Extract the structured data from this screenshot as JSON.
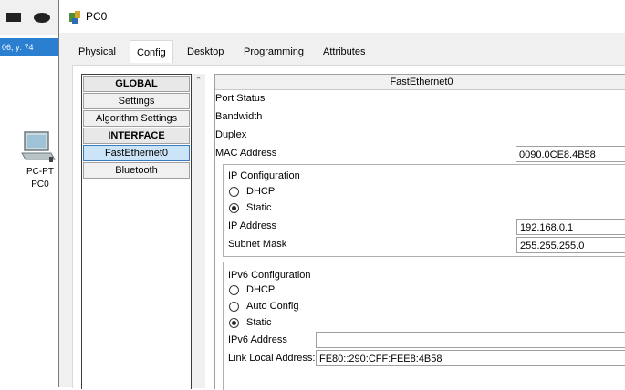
{
  "canvas": {
    "coords_label": "06, y: 74",
    "device_type": "PC-PT",
    "device_name": "PC0"
  },
  "window": {
    "title": "PC0",
    "tabs": [
      {
        "label": "Physical",
        "active": false
      },
      {
        "label": "Config",
        "active": true
      },
      {
        "label": "Desktop",
        "active": false
      },
      {
        "label": "Programming",
        "active": false
      },
      {
        "label": "Attributes",
        "active": false
      }
    ]
  },
  "sidebar": {
    "items": [
      {
        "label": "GLOBAL",
        "kind": "header"
      },
      {
        "label": "Settings",
        "kind": "item"
      },
      {
        "label": "Algorithm Settings",
        "kind": "item"
      },
      {
        "label": "INTERFACE",
        "kind": "header"
      },
      {
        "label": "FastEthernet0",
        "kind": "item",
        "selected": true
      },
      {
        "label": "Bluetooth",
        "kind": "item"
      }
    ]
  },
  "interface": {
    "title": "FastEthernet0",
    "port_status_label": "Port Status",
    "bandwidth_label": "Bandwidth",
    "duplex_label": "Duplex",
    "mac_label": "MAC Address",
    "mac_value": "0090.0CE8.4B58"
  },
  "ip_config": {
    "title": "IP Configuration",
    "dhcp_label": "DHCP",
    "static_label": "Static",
    "selected": "Static",
    "ip_label": "IP Address",
    "ip_value": "192.168.0.1",
    "mask_label": "Subnet Mask",
    "mask_value": "255.255.255.0"
  },
  "ipv6_config": {
    "title": "IPv6 Configuration",
    "dhcp_label": "DHCP",
    "auto_label": "Auto Config",
    "static_label": "Static",
    "selected": "Static",
    "address_label": "IPv6 Address",
    "address_value": "",
    "link_local_label": "Link Local Address:",
    "link_local_value": "FE80::290:CFF:FEE8:4B58"
  },
  "colors": {
    "accent": "#1f88d6",
    "selection": "#cce4f7",
    "coords_bg": "#2a7fd0"
  }
}
